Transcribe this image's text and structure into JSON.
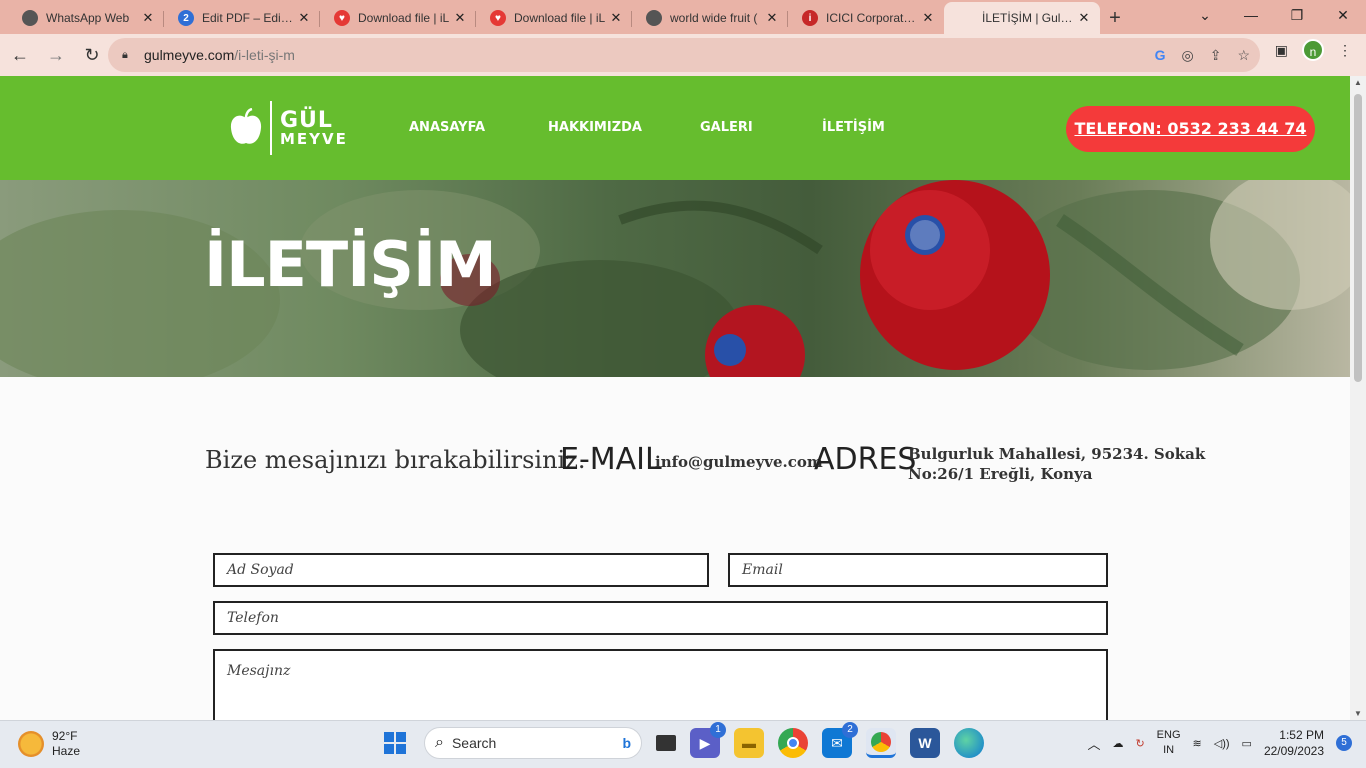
{
  "browser": {
    "tabs": [
      {
        "title": "WhatsApp Web",
        "favicon": "globe-icon",
        "color": "#555555"
      },
      {
        "title": "Edit PDF – Edit PDF",
        "favicon": "pdf-edit-icon",
        "color": "#2f6fd6"
      },
      {
        "title": "Download file | iL",
        "favicon": "heart-icon",
        "color": "#e53935"
      },
      {
        "title": "Download file | iL",
        "favicon": "heart-icon",
        "color": "#e53935"
      },
      {
        "title": "world wide fruit (",
        "favicon": "globe-icon",
        "color": "#555555"
      },
      {
        "title": "ICICI Corporate e",
        "favicon": "icici-icon",
        "color": "#c62828"
      },
      {
        "title": "İLETİŞİM | Gulme",
        "favicon": "none",
        "color": "#f6e2dc"
      }
    ],
    "new_tab": "+",
    "url_host": "gulmeyve.com",
    "url_path": "/i-leti-şi-m",
    "profile_initial": "n"
  },
  "site": {
    "logo_top": "GÜL",
    "logo_bottom": "MEYVE",
    "nav": [
      "ANASAYFA",
      "HAKKIMIZDA",
      "GALERI",
      "İLETİŞİM"
    ],
    "phone": "TELEFON: 0532 233 44 74",
    "hero_title": "İLETİŞİM",
    "message_intro": "Bize mesajınızı bırakabilirsiniz.",
    "email_label": "E-MAIL",
    "email_value": "info@gulmeyve.com",
    "address_label": "ADRES",
    "address_line1": "Bulgurluk Mahallesi, 95234. Sokak",
    "address_line2": "No:26/1 Ereğli, Konya",
    "form": {
      "name_placeholder": "Ad Soyad",
      "email_placeholder": "Email",
      "phone_placeholder": "Telefon",
      "message_placeholder": "Mesajınz"
    },
    "colors": {
      "nav_green": "#66bd2e",
      "phone_red": "#f43a3a"
    }
  },
  "taskbar": {
    "temperature": "92°F",
    "weather": "Haze",
    "search": "Search",
    "teams_badge": "1",
    "mail_badge": "2",
    "language": "ENG",
    "region": "IN",
    "time": "1:52 PM",
    "date": "22/09/2023",
    "notifications": "5"
  }
}
